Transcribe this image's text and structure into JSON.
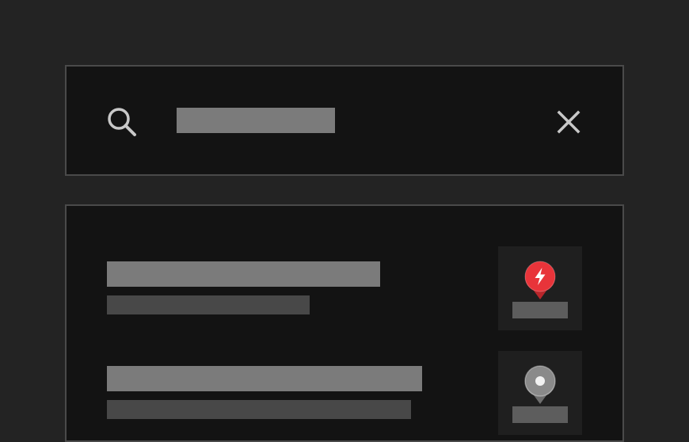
{
  "search": {
    "value": "",
    "placeholder": "",
    "icon": "search-icon",
    "clear_icon": "close-icon"
  },
  "results": [
    {
      "marker": "lightning-pin-icon",
      "marker_color": "#e8343a"
    },
    {
      "marker": "location-pin-icon",
      "marker_color": "#8a8a8a"
    }
  ],
  "colors": {
    "background": "#232323",
    "panel": "#131313",
    "panel_border": "#4a4a4a",
    "primary_text_placeholder": "#7b7b7b",
    "secondary_text_placeholder": "#484848",
    "marker_tile": "#1f1f1f",
    "accent_red": "#e8343a"
  }
}
